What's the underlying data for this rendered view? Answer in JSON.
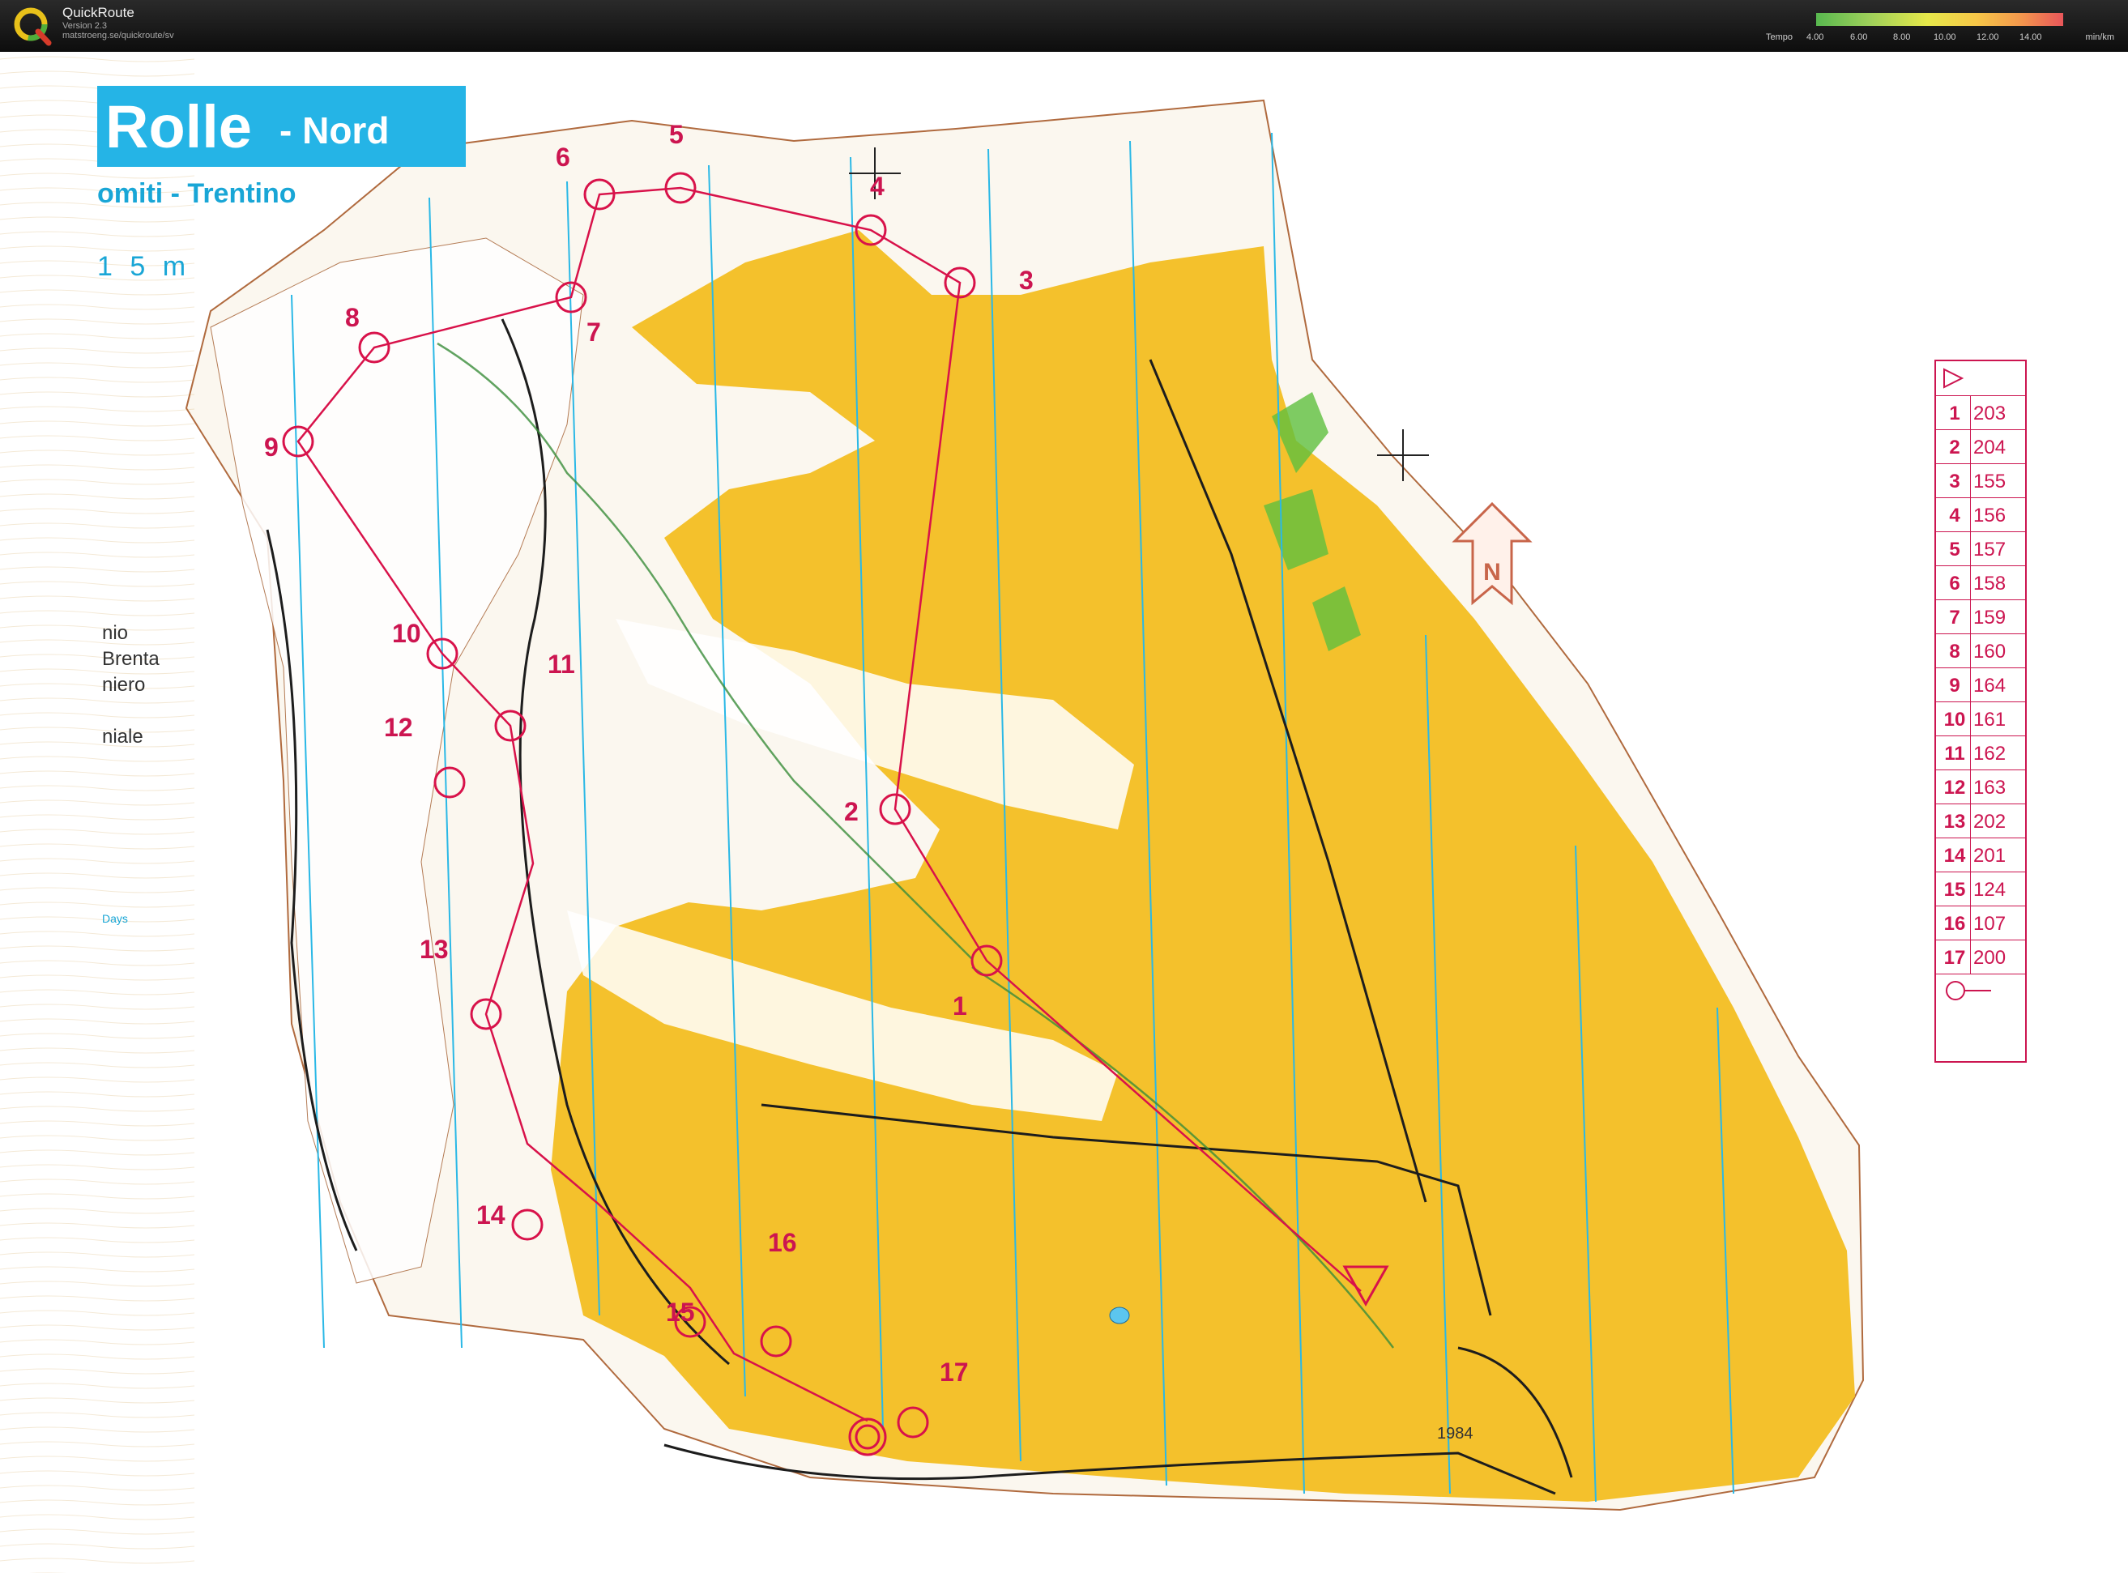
{
  "app": {
    "name": "QuickRoute",
    "version": "Version 2.3",
    "url": "matstroeng.se/quickroute/sv"
  },
  "tempo_legend": {
    "label": "Tempo",
    "ticks": [
      "4.00",
      "6.00",
      "8.00",
      "10.00",
      "12.00",
      "14.00"
    ],
    "unit": "min/km"
  },
  "map": {
    "title": "Rolle",
    "subtitle": "- Nord",
    "region": "omiti - Trentino",
    "scale_fragment": "1 5 m",
    "side_text": [
      "nio",
      "Brenta",
      "niero",
      "niale"
    ],
    "logo_text": "Days",
    "north_label": "N",
    "spot_height": "1984",
    "colors": {
      "open_land": "#f4c12c",
      "course": "#d8124a",
      "road": "#1d1d1d",
      "meridian": "#2ab8e6"
    }
  },
  "controls": [
    {
      "label": "1"
    },
    {
      "label": "2"
    },
    {
      "label": "3"
    },
    {
      "label": "4"
    },
    {
      "label": "5"
    },
    {
      "label": "6"
    },
    {
      "label": "7"
    },
    {
      "label": "8"
    },
    {
      "label": "9"
    },
    {
      "label": "10"
    },
    {
      "label": "11"
    },
    {
      "label": "12"
    },
    {
      "label": "13"
    },
    {
      "label": "14"
    },
    {
      "label": "15"
    },
    {
      "label": "16"
    },
    {
      "label": "17"
    }
  ],
  "control_descriptions": [
    {
      "num": "1",
      "code": "203"
    },
    {
      "num": "2",
      "code": "204"
    },
    {
      "num": "3",
      "code": "155"
    },
    {
      "num": "4",
      "code": "156"
    },
    {
      "num": "5",
      "code": "157"
    },
    {
      "num": "6",
      "code": "158"
    },
    {
      "num": "7",
      "code": "159"
    },
    {
      "num": "8",
      "code": "160"
    },
    {
      "num": "9",
      "code": "164"
    },
    {
      "num": "10",
      "code": "161"
    },
    {
      "num": "11",
      "code": "162"
    },
    {
      "num": "12",
      "code": "163"
    },
    {
      "num": "13",
      "code": "202"
    },
    {
      "num": "14",
      "code": "201"
    },
    {
      "num": "15",
      "code": "124"
    },
    {
      "num": "16",
      "code": "107"
    },
    {
      "num": "17",
      "code": "200"
    }
  ]
}
